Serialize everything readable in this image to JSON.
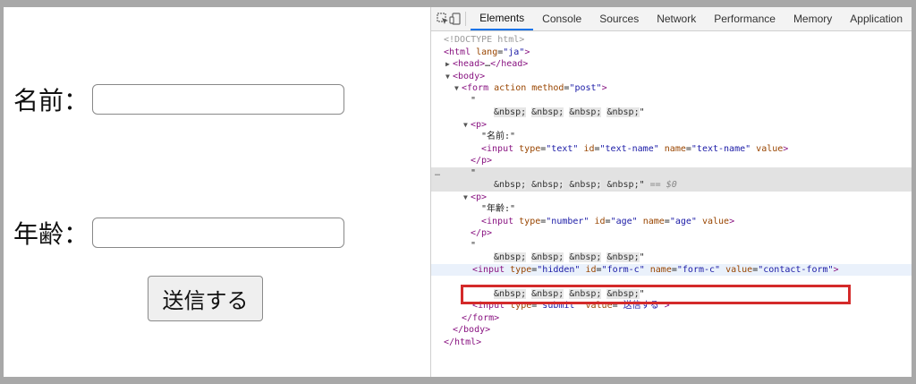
{
  "form_preview": {
    "name_label": "名前：",
    "age_label": "年齢：",
    "submit_label": "送信する"
  },
  "devtools": {
    "tabs": [
      "Elements",
      "Console",
      "Sources",
      "Network",
      "Performance",
      "Memory",
      "Application"
    ],
    "active_tab": "Elements",
    "dom": {
      "doctype": "<!DOCTYPE html>",
      "html_open_tag": "<html",
      "lang_attr": "lang",
      "lang_val": "\"ja\"",
      "gt": ">",
      "head_open": "<head>",
      "ellipsis": "…",
      "head_close": "</head>",
      "body_open": "<body>",
      "form_open_tag": "<form",
      "action_attr": "action",
      "method_attr": "method",
      "method_val": "\"post\"",
      "quote": "\"",
      "nbsp": "&nbsp;",
      "selected_marker": "== $0",
      "p_open": "<p>",
      "p_close": "</p>",
      "name_text": "\"名前:\"",
      "input_open": "<input",
      "type_attr": "type",
      "id_attr": "id",
      "name_attr": "name",
      "value_attr": "value",
      "text_type": "\"text\"",
      "text_name_id": "\"text-name\"",
      "age_text": "\"年齢:\"",
      "number_type": "\"number\"",
      "age_id": "\"age\"",
      "hidden_type": "\"hidden\"",
      "form_c_id": "\"form-c\"",
      "contact_form_value": "\"contact-form\"",
      "submit_type": "\"submit\"",
      "submit_value": "\"送信する\"",
      "form_close": "</form>",
      "body_close": "</body>",
      "html_close": "</html>",
      "ellipsis_gutter": "…"
    }
  }
}
